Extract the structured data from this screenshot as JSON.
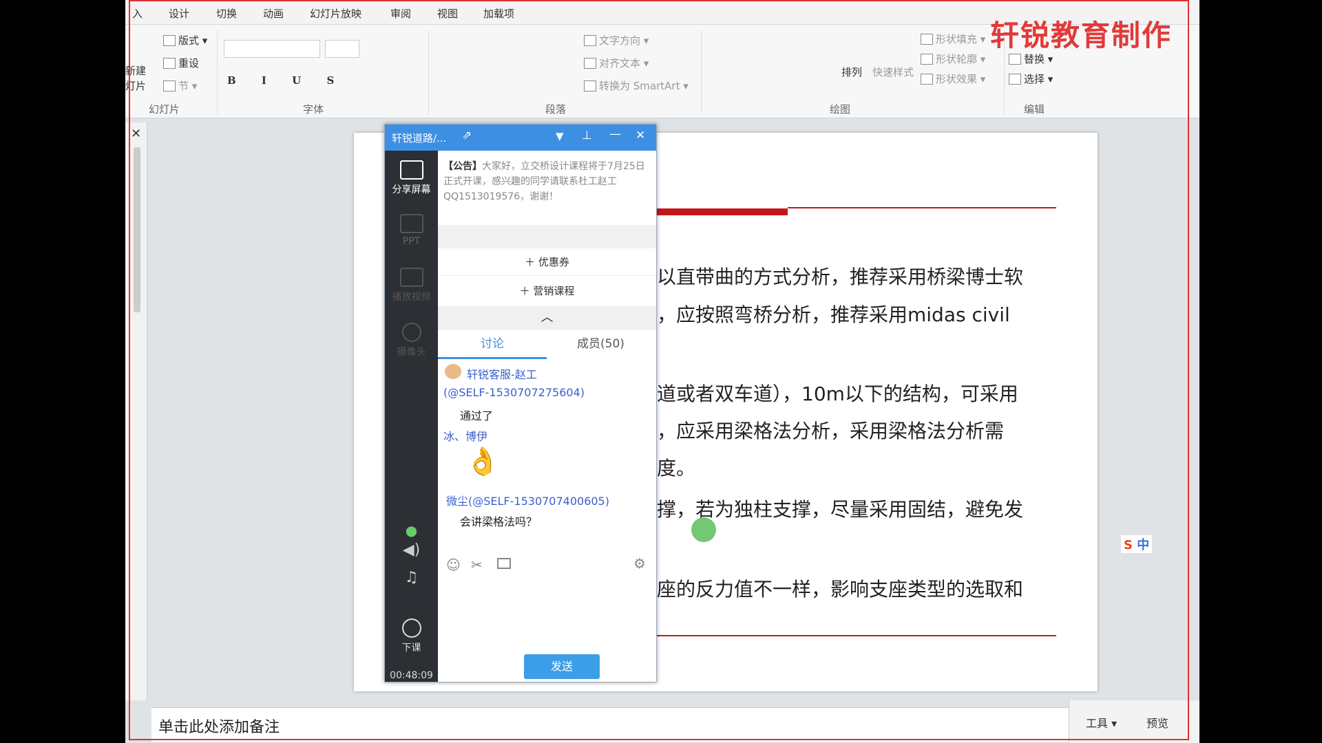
{
  "tabs": [
    "入",
    "设计",
    "切换",
    "动画",
    "幻灯片放映",
    "审阅",
    "视图",
    "加载项"
  ],
  "ribbon": {
    "slides": {
      "new_top": "新建",
      "new_bottom": "灯片",
      "layout": "版式",
      "reset": "重设",
      "section": "节",
      "label": "幻灯片"
    },
    "font": {
      "label": "字体"
    },
    "paragraph": {
      "text_direction": "文字方向",
      "align_text": "对齐文本",
      "smartart": "转换为 SmartArt",
      "label": "段落"
    },
    "drawing": {
      "arrange": "排列",
      "quick_styles": "快速样式",
      "shape_fill": "形状填充",
      "shape_outline": "形状轮廓",
      "shape_effects": "形状效果",
      "label": "绘图"
    },
    "editing": {
      "replace": "替换",
      "select": "选择",
      "label": "编辑"
    }
  },
  "brand": "轩锐教育制作",
  "slide": {
    "lines": [
      "以直带曲的方式分析，推荐采用桥梁博士软",
      "，应按照弯桥分析，推荐采用midas civil",
      "道或者双车道），10m以下的结构，可采用",
      "，应采用梁格法分析，采用梁格法分析需",
      "度。",
      "撑，若为独柱支撑，尽量采用固结，避免发",
      "座的反力值不一样，影响支座类型的选取和"
    ]
  },
  "notes": "单击此处添加备注",
  "status": {
    "tools": "工具",
    "preview": "预览"
  },
  "ime": "中",
  "chat": {
    "title": "轩锐道路/...",
    "sidebar": {
      "share": "分享屏幕",
      "ppt": "PPT",
      "video": "播放视频",
      "camera": "摄像头",
      "end": "下课",
      "timer": "00:48:09"
    },
    "announcement": {
      "tag": "【公告】",
      "text": "大家好，立交桥设计课程将于7月25日正式开课，感兴趣的同学请联系杜工赵工QQ1513019576，谢谢！"
    },
    "coupon": "优惠券",
    "course": "营销课程",
    "tab_discuss": "讨论",
    "tab_members": "成员(50)",
    "messages": [
      {
        "name": "轩锐客服-赵工",
        "id": "(@SELF-1530707275604)",
        "text": "通过了"
      },
      {
        "name": "冰、博伊",
        "text": "👌"
      },
      {
        "name": "微尘(@SELF-1530707400605)",
        "text": "会讲梁格法吗？"
      }
    ],
    "send": "发送"
  }
}
